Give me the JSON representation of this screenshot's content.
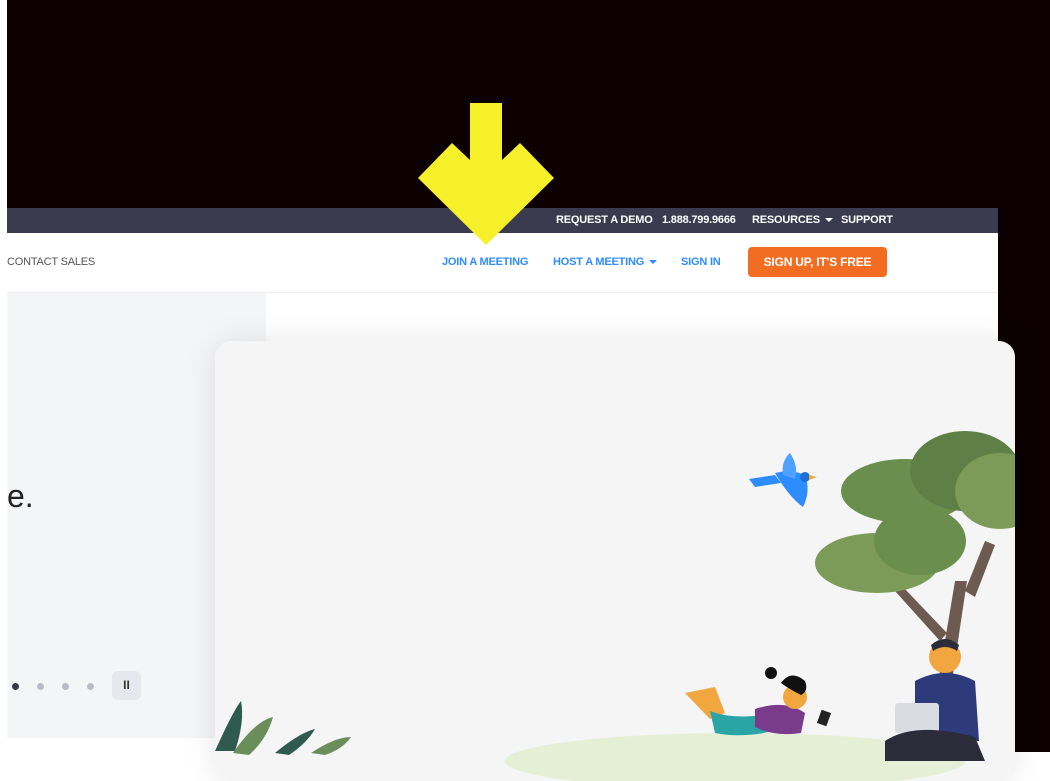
{
  "top_bar": {
    "request_demo": "REQUEST A DEMO",
    "phone": "1.888.799.9666",
    "resources": "RESOURCES",
    "support": "SUPPORT"
  },
  "nav": {
    "contact_sales": "CONTACT SALES",
    "join_meeting": "JOIN A MEETING",
    "host_meeting": "HOST A MEETING",
    "sign_in": "SIGN IN",
    "sign_up": "SIGN UP, IT'S FREE"
  },
  "hero": {
    "headline_tail": "e."
  },
  "carousel": {
    "pause_label": "II",
    "active_index": 0,
    "slide_count": 4
  },
  "colors": {
    "brand_blue": "#2d8cff",
    "cta_orange": "#f26d21",
    "top_bar_bg": "#3b3b4f",
    "annotation_arrow": "#f5f02a"
  },
  "icons": [
    "caret-down-icon",
    "pause-icon",
    "annotation-arrow-icon"
  ]
}
